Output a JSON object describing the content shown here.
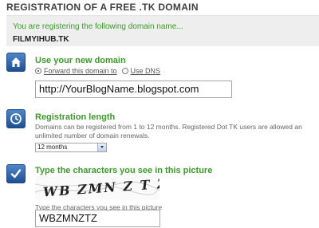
{
  "page": {
    "title": "REGISTRATION OF A FREE .TK DOMAIN"
  },
  "banner": {
    "message": "You are registering the following domain name...",
    "domain": "FILMYIHUB.TK"
  },
  "domain_section": {
    "heading": "Use your new domain",
    "option_forward": "Forward this domain to",
    "option_dns": "Use DNS",
    "url_value": "http://YourBlogName.blogspot.com"
  },
  "length_section": {
    "heading": "Registration length",
    "description": "Domains can be registered from 1 to 12 months. Registered Dot TK users are allowed an unlimited number of domain renewals.",
    "selected": "12 months"
  },
  "captcha_section": {
    "heading": "Type the characters you see in this picture",
    "captcha_text": "WB ZMN Z T Z",
    "label": "Type the characters you see in this picture",
    "input_value": "WBZMNZTZ"
  },
  "icons": {
    "domain": "home-icon",
    "length": "clock-icon",
    "captcha": "checkmark-icon",
    "accent_color": "#3c9a2a",
    "icon_color": "#2b5fa6"
  }
}
